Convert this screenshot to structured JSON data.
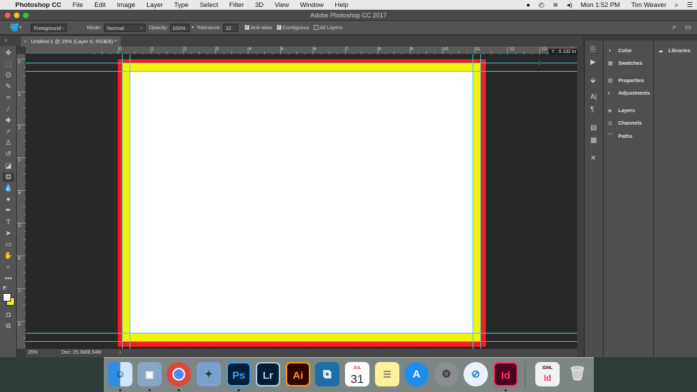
{
  "menubar": {
    "app_name": "Photoshop CC",
    "items": [
      "File",
      "Edit",
      "Image",
      "Layer",
      "Type",
      "Select",
      "Filter",
      "3D",
      "View",
      "Window",
      "Help"
    ],
    "clock": "Mon 1:52 PM",
    "user": "Tim Weaver"
  },
  "window": {
    "title": "Adobe Photoshop CC 2017"
  },
  "options": {
    "fill_source": "Foreground",
    "mode_label": "Mode:",
    "mode_value": "Normal",
    "opacity_label": "Opacity:",
    "opacity_value": "100%",
    "tolerance_label": "Tolerance:",
    "tolerance_value": "32",
    "anti_alias_label": "Anti-alias",
    "contiguous_label": "Contiguous",
    "all_layers_label": "All Layers",
    "anti_alias_checked": true,
    "contiguous_checked": true,
    "all_layers_checked": false
  },
  "document": {
    "tab_close": "×",
    "tab_label": "Untitled-1 @ 25% (Layer 0, RGB/8) *",
    "tooltip": "Y : 0.132 in"
  },
  "rulers": {
    "top": [
      "0",
      "1",
      "2",
      "3",
      "4",
      "5",
      "6",
      "7",
      "8",
      "9",
      "10",
      "11",
      "12",
      "13"
    ],
    "left": [
      "0",
      "1",
      "2",
      "3",
      "4",
      "5",
      "6",
      "7",
      "8"
    ]
  },
  "status": {
    "zoom": "25%",
    "doc": "Doc: 25.3M/8.54M",
    "arrow": "›"
  },
  "panels": {
    "group1": [
      "Color",
      "Swatches"
    ],
    "group2": [
      "Properties",
      "Adjustments"
    ],
    "group3": [
      "Layers",
      "Channels",
      "Paths"
    ],
    "libraries": "Libraries"
  },
  "dock": {
    "ps": "Ps",
    "lr": "Lr",
    "ai": "Ai",
    "id": "Id",
    "cal_month": "JUL",
    "cal_day": "31",
    "idml": "IDML"
  },
  "colors": {
    "border_red": "#ff1a1a",
    "border_yellow": "#f2f20a",
    "guide": "#38d1d1",
    "canvas_bg": "#282828"
  }
}
